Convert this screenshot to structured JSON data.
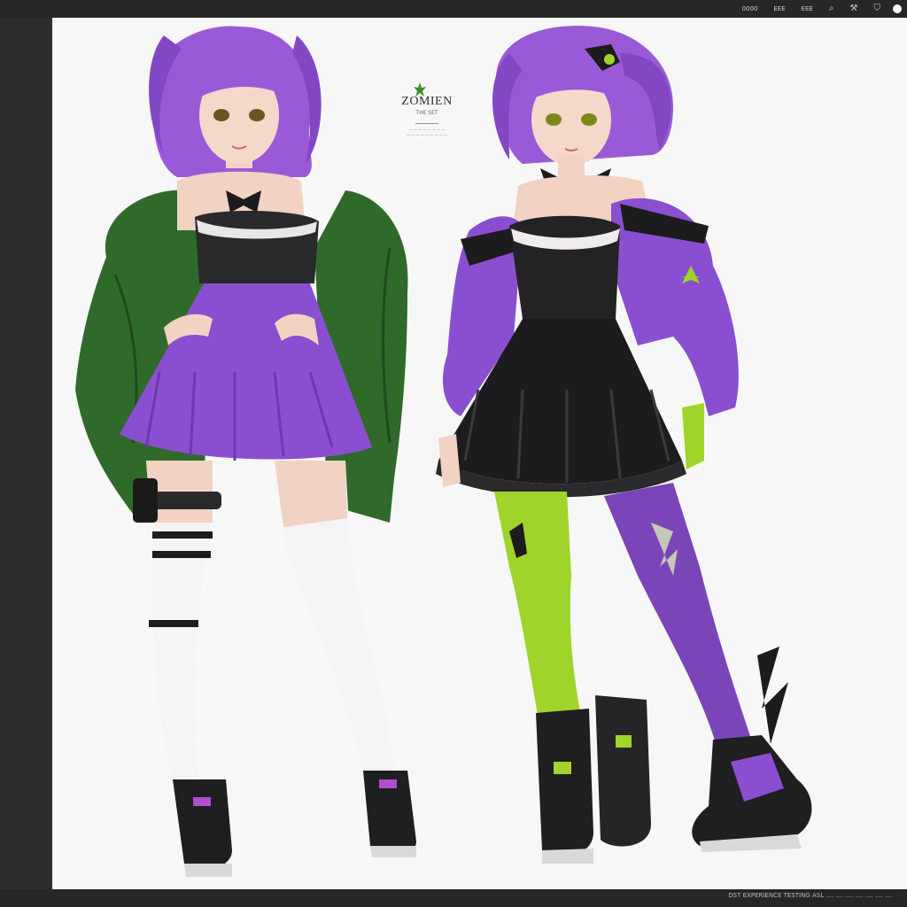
{
  "toolbar": {
    "items": [
      {
        "label": "0000",
        "icon": "text-tool"
      },
      {
        "label": "EEE",
        "icon": "text-tool"
      },
      {
        "label": "EEE",
        "icon": "text-tool"
      },
      {
        "label": "⌕",
        "icon": "search-icon"
      },
      {
        "label": "⚒",
        "icon": "hammer-icon"
      },
      {
        "label": "⛉",
        "icon": "shield-icon"
      }
    ]
  },
  "sheet": {
    "logo": "ZOMIEN",
    "subtitle": "THE SET",
    "caption_lines": [
      "— — — — — — — —",
      "— — — — — — — — —"
    ]
  },
  "status": {
    "text": "DST EXPERIENCE  TESTING  ASL  ....  ....  ....  ....  ....  ....  ...."
  },
  "colors": {
    "purple": "#8a4fd0",
    "green_jacket": "#2f6a2a",
    "lime": "#9fd42a",
    "black": "#1c1b1d"
  }
}
